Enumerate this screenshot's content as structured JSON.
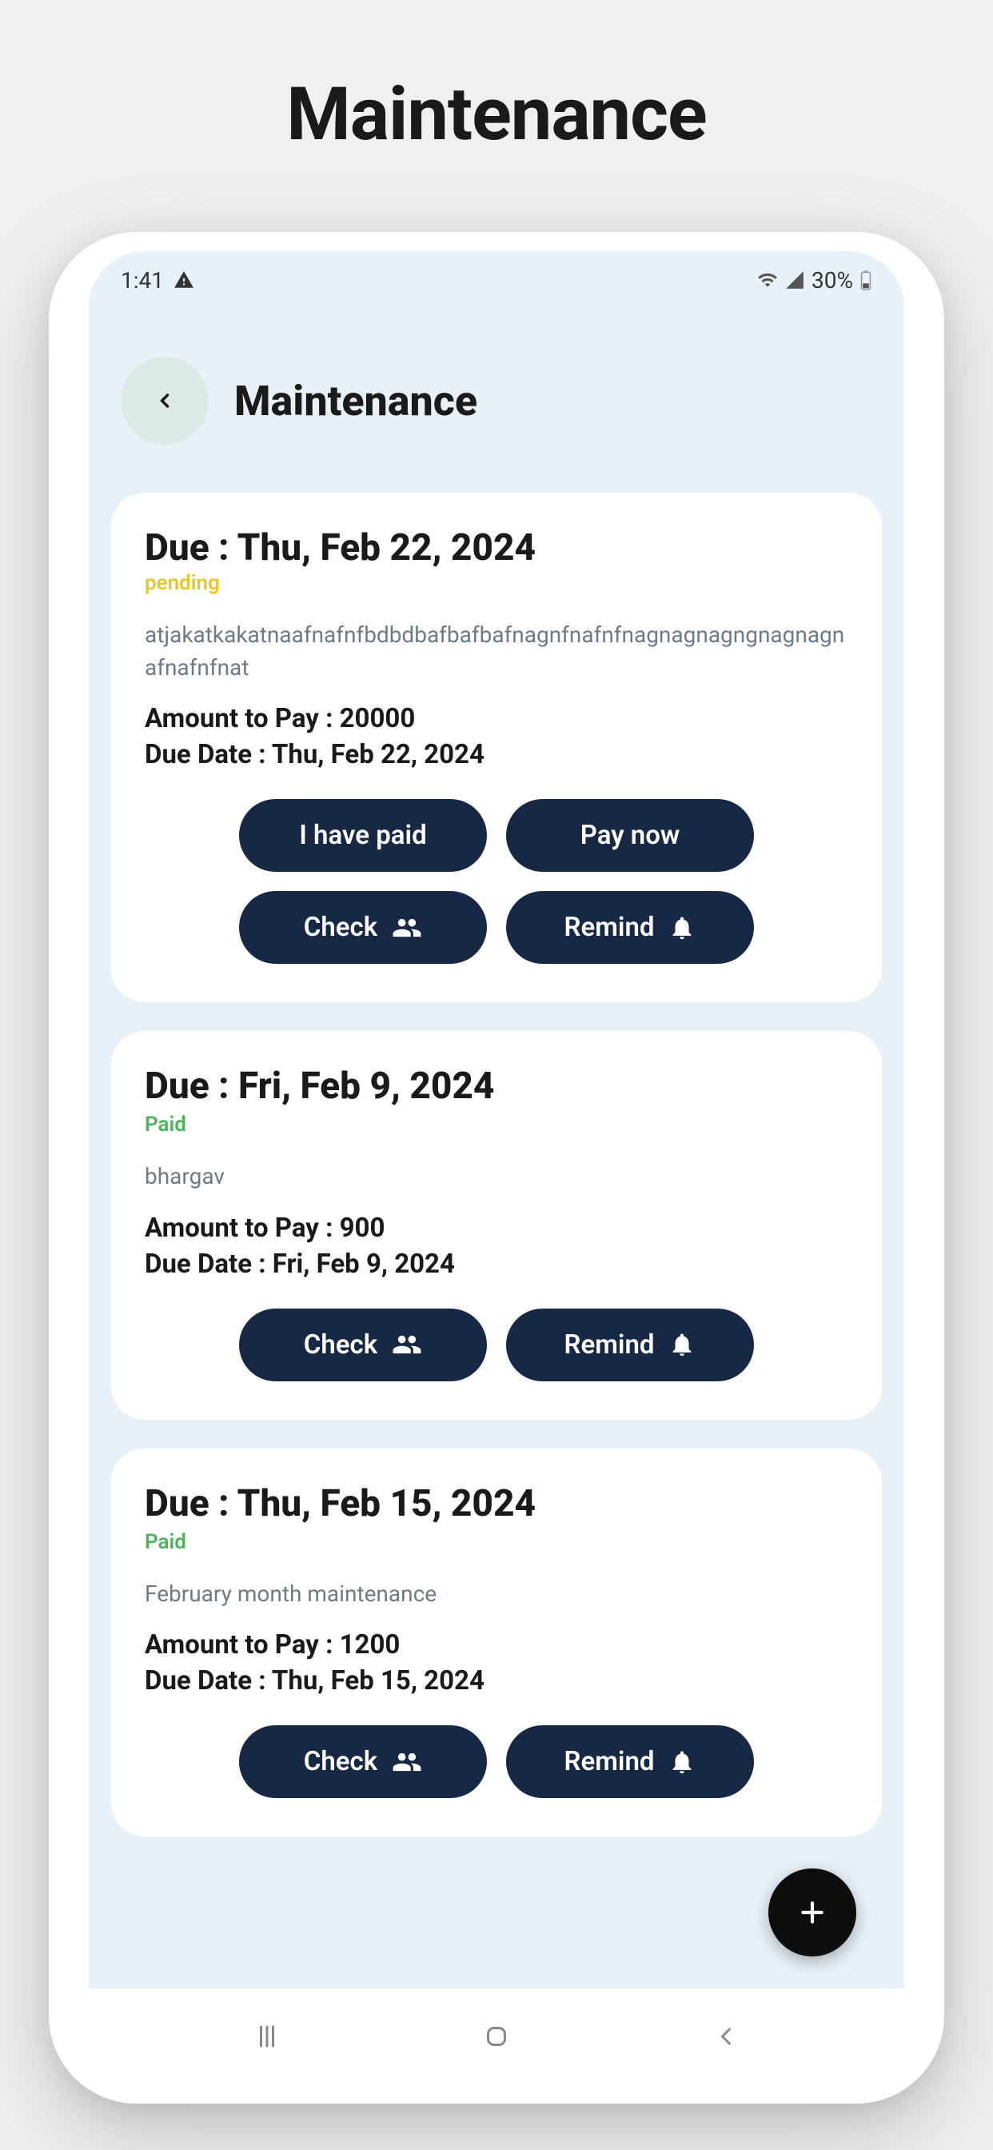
{
  "externalTitle": "Maintenance",
  "statusBar": {
    "time": "1:41",
    "batteryPercent": "30%"
  },
  "header": {
    "title": "Maintenance"
  },
  "labels": {
    "duePrefix": "Due : ",
    "amountPrefix": "Amount to Pay : ",
    "dueDatePrefix": "Due Date : ",
    "pending": "pending",
    "paid": "Paid",
    "iHavePaid": "I have paid",
    "payNow": "Pay now",
    "check": "Check",
    "remind": "Remind"
  },
  "items": [
    {
      "dueTitle": "Thu, Feb 22, 2024",
      "status": "pending",
      "description": "atjakatkakatnaafnafnfbdbdbafbafbafnagnfnafnfnagnagnagngnagnagnafnafnfnat",
      "amount": "20000",
      "dueDate": "Thu, Feb 22, 2024",
      "showPayButtons": true
    },
    {
      "dueTitle": "Fri, Feb 9, 2024",
      "status": "paid",
      "description": "bhargav",
      "amount": "900",
      "dueDate": "Fri, Feb 9, 2024",
      "showPayButtons": false
    },
    {
      "dueTitle": "Thu, Feb 15, 2024",
      "status": "paid",
      "description": "February month maintenance",
      "amount": "1200",
      "dueDate": "Thu, Feb 15, 2024",
      "showPayButtons": false
    }
  ]
}
